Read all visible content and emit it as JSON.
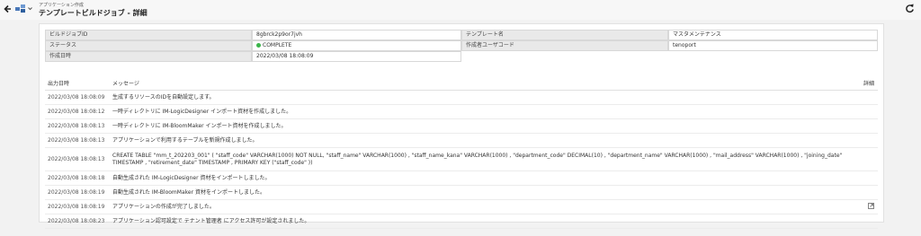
{
  "header": {
    "breadcrumb": "アプリケーション作成",
    "title": "テンプレートビルドジョブ - 詳細"
  },
  "details": {
    "labels": {
      "build_job_id": "ビルドジョブID",
      "template_name": "テンプレート名",
      "status": "ステータス",
      "creator_user_code": "作成者ユーザコード",
      "created_at": "作成日時"
    },
    "values": {
      "build_job_id": "8gbrck2p9or7jvh",
      "template_name": "マスタメンテナンス",
      "status": "COMPLETE",
      "creator_user_code": "tenoport",
      "created_at": "2022/03/08 18:08:09"
    },
    "status_color": "#3bb54a"
  },
  "log": {
    "columns": {
      "time": "出力日時",
      "message": "メッセージ",
      "detail": "詳細"
    },
    "rows": [
      {
        "time": "2022/03/08 18:08:09",
        "message": "生成するリソースのIDを自動設定します。"
      },
      {
        "time": "2022/03/08 18:08:12",
        "message": "一時ディレクトリに IM-LogicDesigner インポート資材を作成しました。"
      },
      {
        "time": "2022/03/08 18:08:13",
        "message": "一時ディレクトリに IM-BloomMaker インポート資材を作成しました。"
      },
      {
        "time": "2022/03/08 18:08:13",
        "message": "アプリケーションで利用するテーブルを新規作成しました。"
      },
      {
        "time": "2022/03/08 18:08:13",
        "message": "CREATE TABLE \"mm_t_202203_001\" ( \"staff_code\" VARCHAR(1000) NOT NULL, \"staff_name\" VARCHAR(1000) , \"staff_name_kana\" VARCHAR(1000) , \"department_code\" DECIMAL(10) , \"department_name\" VARCHAR(1000) , \"mail_address\" VARCHAR(1000) , \"joining_date\" TIMESTAMP , \"retirement_date\" TIMESTAMP , PRIMARY KEY (\"staff_code\" ))"
      },
      {
        "time": "2022/03/08 18:08:18",
        "message": "自動生成された IM-LogicDesigner 資材をインポートしました。"
      },
      {
        "time": "2022/03/08 18:08:19",
        "message": "自動生成された IM-BloomMaker 資材をインポートしました。"
      },
      {
        "time": "2022/03/08 18:08:19",
        "message": "アプリケーションの作成が完了しました。"
      },
      {
        "time": "2022/03/08 18:08:23",
        "message": "アプリケーション認可設定で テナント管理者 にアクセス許可が設定されました。"
      }
    ]
  }
}
